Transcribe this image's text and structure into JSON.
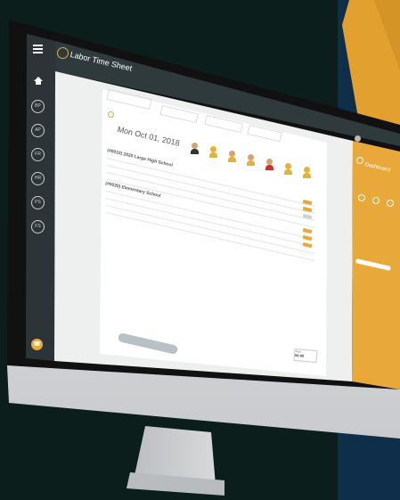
{
  "app": {
    "title": "Labor Time Sheet",
    "date": "Mon Oct 01, 2018"
  },
  "sidebar": {
    "items": [
      {
        "label": "BP",
        "icon": "bp-icon"
      },
      {
        "label": "AP",
        "icon": "ap-icon"
      },
      {
        "label": "FR",
        "icon": "fr-icon"
      },
      {
        "label": "HR",
        "icon": "hr-icon"
      },
      {
        "label": "PS",
        "icon": "ps-icon"
      },
      {
        "label": "FS",
        "icon": "fs-icon"
      }
    ],
    "home_icon": "home-icon",
    "menu_icon": "hamburger-icon",
    "help_icon": "phone-icon"
  },
  "sheet": {
    "groups": [
      {
        "label": "(#0010) 2020 Large High School"
      },
      {
        "label": "(#0020) Elementary School"
      }
    ]
  },
  "right_panel": {
    "title": "Dashboard"
  },
  "footer": {
    "total_label": "Total",
    "total_value": "00:00"
  }
}
